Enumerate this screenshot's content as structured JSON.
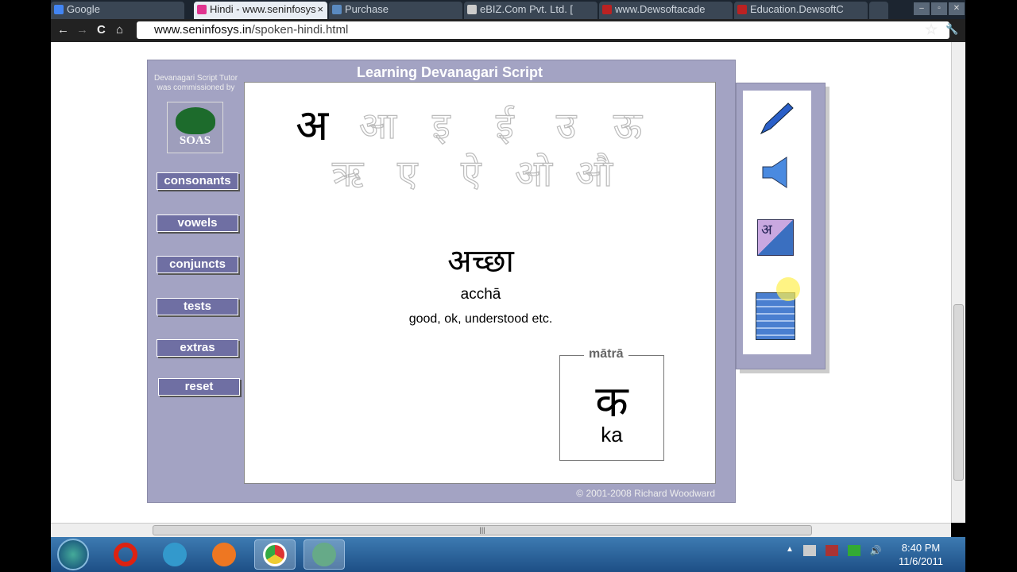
{
  "browser": {
    "tabs": [
      {
        "label": "Google",
        "fav": "#4285f4"
      },
      {
        "label": "Hindi - www.seninfosys",
        "fav": "#e0338f",
        "active": true,
        "close": "×"
      },
      {
        "label": "Purchase",
        "fav": "#5a8ac0"
      },
      {
        "label": "eBIZ.Com Pvt. Ltd. [",
        "fav": "#ccc"
      },
      {
        "label": "www.Dewsoftacade",
        "fav": "#b22"
      },
      {
        "label": "Education.DewsoftC",
        "fav": "#b22"
      }
    ],
    "url_domain": "www.seninfosys.in",
    "url_path": "/spoken-hindi.html",
    "nav": {
      "back": "←",
      "forward": "→",
      "reload": "C",
      "home": "⌂",
      "star": "☆",
      "wrench": "🔧"
    },
    "win": {
      "min": "–",
      "max": "▫",
      "close": "✕"
    }
  },
  "app": {
    "title": "Learning Devanagari Script",
    "commission": "Devanagari Script Tutor was commissioned by",
    "logo": "SOAS",
    "menu": [
      "consonants",
      "vowels",
      "conjuncts",
      "tests",
      "extras",
      "reset"
    ],
    "vowels_row1": [
      "अ",
      "आ",
      "इ",
      "ई",
      "उ",
      "ऊ"
    ],
    "vowels_row2": [
      "ऋ",
      "ए",
      "ऐ",
      "ओ",
      "औ"
    ],
    "word": "अच्छा",
    "translit": "acchā",
    "meaning": "good, ok, understood etc.",
    "matra_label": "mātrā",
    "matra_char": "क",
    "matra_roman": "ka",
    "copyright": "© 2001-2008 Richard Woodward",
    "tools": [
      "pencil-icon",
      "speaker-icon",
      "script-toggle-icon",
      "notes-icon"
    ],
    "tool_script": "अ"
  },
  "hscroll_grip": "|||",
  "taskbar": {
    "time": "8:40 PM",
    "date": "11/6/2011",
    "tray_arrow": "▲",
    "volume": "🔊"
  }
}
